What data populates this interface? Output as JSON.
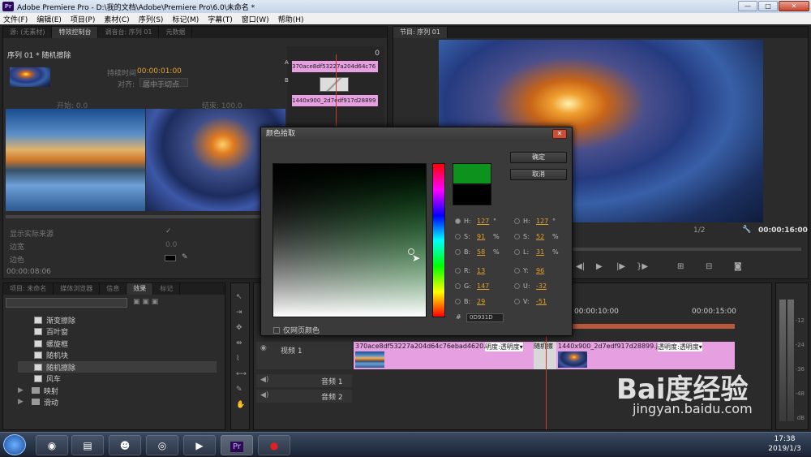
{
  "app": {
    "logo": "Pr",
    "title": "Adobe Premiere Pro - D:\\我的文档\\Adobe\\Premiere Pro\\6.0\\未命名 *",
    "min": "—",
    "max": "□",
    "close": "✕"
  },
  "menu": [
    "文件(F)",
    "编辑(E)",
    "项目(P)",
    "素材(C)",
    "序列(S)",
    "标记(M)",
    "字幕(T)",
    "窗口(W)",
    "帮助(H)"
  ],
  "source_panel": {
    "tabs": [
      "源: (无素材)",
      "特效控制台",
      "调音台: 序列 01",
      "元数据"
    ],
    "sequence_label": "序列 01 * 随机擦除",
    "duration_label": "持续时间",
    "duration_value": "00:00:01:00",
    "align_label": "对齐:",
    "align_value": "居中于切点",
    "start_label": "开始: 0.0",
    "end_label": "结束: 100.0",
    "show_actual": "显示实际来源",
    "border_width_label": "边宽",
    "border_width_value": "0.0",
    "border_color_label": "边色",
    "timecode": "00:00:08:06",
    "clip_a": "370ace8df53227a204d64c76",
    "clip_b": "1440x900_2d7edf917d28899",
    "mini_ruler_num": "0",
    "label_a": "A",
    "label_b": "B"
  },
  "program_panel": {
    "tab": "节目: 序列 01",
    "fraction": "1/2",
    "timecode": "00:00:16:00"
  },
  "color_dialog": {
    "title": "颜色拾取",
    "ok": "确定",
    "cancel": "取消",
    "web_only": "仅网页颜色",
    "hex_label": "#",
    "hex_value": "0D931D",
    "left_values": [
      {
        "label": "H:",
        "value": "127",
        "unit": "°"
      },
      {
        "label": "S:",
        "value": "91",
        "unit": "%"
      },
      {
        "label": "B:",
        "value": "58",
        "unit": "%"
      },
      {
        "label": "R:",
        "value": "13",
        "unit": ""
      },
      {
        "label": "G:",
        "value": "147",
        "unit": ""
      },
      {
        "label": "B:",
        "value": "29",
        "unit": ""
      }
    ],
    "right_values": [
      {
        "label": "H:",
        "value": "127",
        "unit": "°"
      },
      {
        "label": "S:",
        "value": "52",
        "unit": "%"
      },
      {
        "label": "L:",
        "value": "31",
        "unit": "%"
      },
      {
        "label": "Y:",
        "value": "96",
        "unit": ""
      },
      {
        "label": "U:",
        "value": "-32",
        "unit": ""
      },
      {
        "label": "V:",
        "value": "-51",
        "unit": ""
      }
    ],
    "selected_color": "#0d931d"
  },
  "effects_panel": {
    "tabs": [
      "项目: 未命名",
      "媒体浏览器",
      "信息",
      "效果",
      "标记"
    ],
    "items": [
      {
        "label": "渐变擦除",
        "type": "effect"
      },
      {
        "label": "百叶窗",
        "type": "effect"
      },
      {
        "label": "螺旋框",
        "type": "effect"
      },
      {
        "label": "随机块",
        "type": "effect"
      },
      {
        "label": "随机擦除",
        "type": "effect"
      },
      {
        "label": "风车",
        "type": "effect"
      },
      {
        "label": "映射",
        "type": "folder"
      },
      {
        "label": "滑动",
        "type": "folder"
      }
    ]
  },
  "timeline": {
    "ruler": [
      "00:00:10:00",
      "00:00:15:00"
    ],
    "tracks": [
      {
        "label": "视频 1"
      },
      {
        "label": "音频 1"
      },
      {
        "label": "音频 2"
      }
    ],
    "clip1_name": "370ace8df53227a204d64c76ebad4620.jpg",
    "clip1_fx": "明度:透明度▾",
    "transition_label": "随机擦",
    "clip2_name": "1440x900_2d7edf917d28899.jpg",
    "clip2_fx": "透明度:透明度▾"
  },
  "meters": [
    "-12",
    "-24",
    "-36",
    "-48",
    "dB"
  ],
  "taskbar": {
    "time": "17:38",
    "date": "2019/1/3"
  },
  "watermark": {
    "brand": "Bai度经验",
    "url": "jingyan.baidu.com"
  }
}
